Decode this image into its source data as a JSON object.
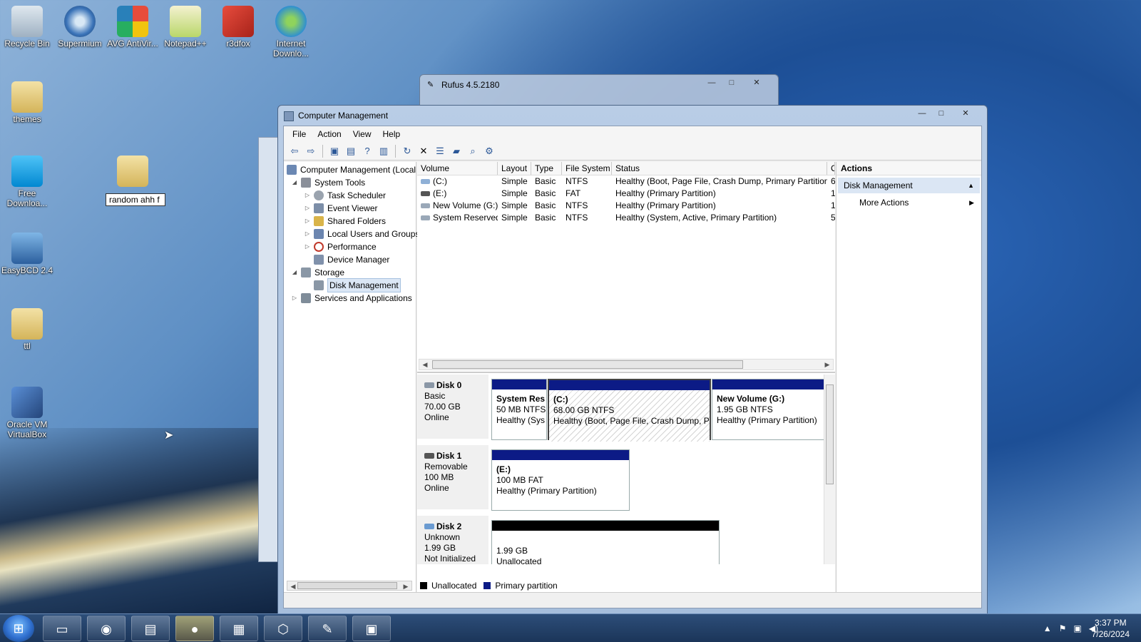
{
  "desktop": {
    "icons": [
      {
        "label": "Recycle Bin"
      },
      {
        "label": "Supermium"
      },
      {
        "label": "AVG AntiVir..."
      },
      {
        "label": "Notepad++"
      },
      {
        "label": "r3dfox"
      },
      {
        "label": "Internet Downlo..."
      },
      {
        "label": "themes"
      },
      {
        "label": "Free Downloa..."
      },
      {
        "label": "EasyBCD 2.4"
      },
      {
        "label": "ttl"
      },
      {
        "label": "Oracle VM VirtualBox"
      }
    ],
    "rename_value": "random ahh f"
  },
  "rufus": {
    "title": "Rufus 4.5.2180",
    "controls": {
      "minimize": "—",
      "maximize": "□",
      "close": "✕"
    }
  },
  "window": {
    "title": "Computer Management",
    "controls": {
      "minimize": "—",
      "maximize": "□",
      "close": "✕"
    },
    "menu": [
      "File",
      "Action",
      "View",
      "Help"
    ],
    "tree": [
      {
        "label": "Computer Management (Local",
        "twisty": "",
        "icon_color": "#6b88b3"
      },
      {
        "label": "System Tools",
        "twisty": "◢",
        "icon_color": "#8a8f99"
      },
      {
        "label": "Task Scheduler",
        "twisty": "▷",
        "icon_color": "#9aa3ae"
      },
      {
        "label": "Event Viewer",
        "twisty": "▷",
        "icon_color": "#7c8ea8"
      },
      {
        "label": "Shared Folders",
        "twisty": "▷",
        "icon_color": "#d9b44a"
      },
      {
        "label": "Local Users and Groups",
        "twisty": "▷",
        "icon_color": "#6c86b0"
      },
      {
        "label": "Performance",
        "twisty": "▷",
        "icon_color": "#c0392b"
      },
      {
        "label": "Device Manager",
        "twisty": "",
        "icon_color": "#8091ab"
      },
      {
        "label": "Storage",
        "twisty": "◢",
        "icon_color": "#8a97a6"
      },
      {
        "label": "Disk Management",
        "twisty": "",
        "icon_color": "#8a97a6"
      },
      {
        "label": "Services and Applications",
        "twisty": "▷",
        "icon_color": "#7f8c99"
      }
    ],
    "volume_table": {
      "headers": [
        "Volume",
        "Layout",
        "Type",
        "File System",
        "Status",
        "C"
      ],
      "rows": [
        {
          "volume": "(C:)",
          "layout": "Simple",
          "type": "Basic",
          "fs": "NTFS",
          "status": "Healthy (Boot, Page File, Crash Dump, Primary Partition)",
          "cap": "6"
        },
        {
          "volume": "(E:)",
          "layout": "Simple",
          "type": "Basic",
          "fs": "FAT",
          "status": "Healthy (Primary Partition)",
          "cap": "1"
        },
        {
          "volume": "New Volume (G:)",
          "layout": "Simple",
          "type": "Basic",
          "fs": "NTFS",
          "status": "Healthy (Primary Partition)",
          "cap": "1"
        },
        {
          "volume": "System Reserved",
          "layout": "Simple",
          "type": "Basic",
          "fs": "NTFS",
          "status": "Healthy (System, Active, Primary Partition)",
          "cap": "5"
        }
      ]
    },
    "disks": [
      {
        "name": "Disk 0",
        "kind": "Basic",
        "size": "70.00 GB",
        "state": "Online",
        "partitions": [
          {
            "line1": "System Res",
            "line2": "50 MB NTFS",
            "line3": "Healthy (Sys"
          },
          {
            "line1": "(C:)",
            "line2": "68.00 GB NTFS",
            "line3": "Healthy (Boot, Page File, Crash Dump, Pr"
          },
          {
            "line1": "New Volume  (G:)",
            "line2": "1.95 GB NTFS",
            "line3": "Healthy (Primary Partition)"
          }
        ]
      },
      {
        "name": "Disk 1",
        "kind": "Removable",
        "size": "100 MB",
        "state": "Online",
        "partitions": [
          {
            "line1": "(E:)",
            "line2": "100 MB FAT",
            "line3": "Healthy (Primary Partition)"
          }
        ]
      },
      {
        "name": "Disk 2",
        "kind": "Unknown",
        "size": "1.99 GB",
        "state": "Not Initialized",
        "partitions": [
          {
            "line1": "",
            "line2": "1.99 GB",
            "line3": "Unallocated"
          }
        ]
      }
    ],
    "legend": {
      "unallocated": "Unallocated",
      "primary": "Primary partition",
      "unallocated_color": "#000000",
      "primary_color": "#0c1b86"
    },
    "actions": {
      "header": "Actions",
      "section": "Disk Management",
      "item": "More Actions"
    }
  },
  "taskbar": {
    "clock_time": "3:37 PM",
    "clock_date": "7/26/2024"
  }
}
